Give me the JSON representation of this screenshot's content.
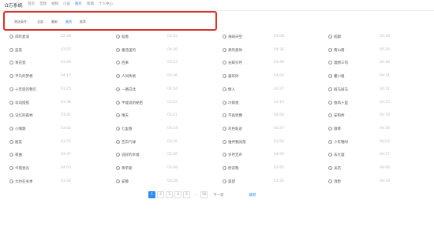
{
  "header": {
    "brand": "Ω方系统",
    "nav": [
      "首页",
      "音频",
      "视频",
      "小说",
      "图片",
      "新闻",
      "个人中心"
    ],
    "active_nav_index": 4
  },
  "filter": {
    "label": "筛选条件：",
    "options": [
      "全部",
      "最新",
      "最热",
      "推荐"
    ],
    "active_index": 2
  },
  "columns": [
    [
      {
        "name": "风吹麦浪",
        "dur": "02:48"
      },
      {
        "name": "蓝莲",
        "dur": "03:55"
      },
      {
        "name": "青花瓷",
        "dur": "03:49"
      },
      {
        "name": "平凡的梦想",
        "dur": "04:17"
      },
      {
        "name": "十年后的我们",
        "dur": "03:25"
      },
      {
        "name": "勾勾搭搭",
        "dur": "03:39"
      },
      {
        "name": "记忆的森林",
        "dur": "03:41"
      },
      {
        "name": "小情歌",
        "dur": "03:42"
      },
      {
        "name": "朋友",
        "dur": "03:55"
      },
      {
        "name": "夜曲",
        "dur": "03:47"
      },
      {
        "name": "今夜星光",
        "dur": "04:03"
      },
      {
        "name": "大约在冬季",
        "dur": "03:30"
      }
    ],
    [
      {
        "name": "稻香",
        "dur": "03:42"
      },
      {
        "name": "童话里的",
        "dur": "04:26"
      },
      {
        "name": "后来",
        "dur": "03:23"
      },
      {
        "name": "人间失格",
        "dur": "03:36"
      },
      {
        "name": "一路向北",
        "dur": "04:54"
      },
      {
        "name": "不能说的秘密",
        "dur": "03:42"
      },
      {
        "name": "晴天",
        "dur": "03:21"
      },
      {
        "name": "七里香",
        "dur": "03:34"
      },
      {
        "name": "告白气球",
        "dur": "03:35"
      },
      {
        "name": "说好的幸福",
        "dur": "03:36"
      },
      {
        "name": "简单爱",
        "dur": "03:48"
      },
      {
        "name": "安静",
        "dur": "03:28"
      }
    ],
    [
      {
        "name": "海阔天空",
        "dur": "03:08"
      },
      {
        "name": "真的爱你",
        "dur": "04:36"
      },
      {
        "name": "光辉岁月",
        "dur": "03:40"
      },
      {
        "name": "喜欢你",
        "dur": "04:00"
      },
      {
        "name": "情人",
        "dur": "03:37"
      },
      {
        "name": "冷雨夜",
        "dur": "03:10"
      },
      {
        "name": "不再犹豫",
        "dur": "04:04"
      },
      {
        "name": "灰色轨迹",
        "dur": "03:47"
      },
      {
        "name": "谁伴我闯荡",
        "dur": "03:56"
      },
      {
        "name": "岁月无声",
        "dur": "04:09"
      },
      {
        "name": "原谅我",
        "dur": "03:55"
      },
      {
        "name": "遥望",
        "dur": "03:20"
      }
    ],
    [
      {
        "name": "成都",
        "dur": "05:28"
      },
      {
        "name": "南山南",
        "dur": "05:24"
      },
      {
        "name": "理想三旬",
        "dur": "04:48"
      },
      {
        "name": "董小姐",
        "dur": "04:31"
      },
      {
        "name": "斑马斑马",
        "dur": "04:31"
      },
      {
        "name": "春风十里",
        "dur": "04:53"
      },
      {
        "name": "安和桥",
        "dur": "04:18"
      },
      {
        "name": "傲寒",
        "dur": "04:30"
      },
      {
        "name": "少年锦时",
        "dur": "04:03"
      },
      {
        "name": "去大理",
        "dur": "04:27"
      },
      {
        "name": "米店",
        "dur": "04:08"
      },
      {
        "name": "消愁",
        "dur": "04:18"
      }
    ]
  ],
  "pagination": {
    "pages": [
      "1",
      "2",
      "3",
      "4",
      "5"
    ],
    "ellipsis": "…",
    "last": "16",
    "active_index": 0,
    "next_label": "下一页",
    "jump_label": "跳转"
  }
}
